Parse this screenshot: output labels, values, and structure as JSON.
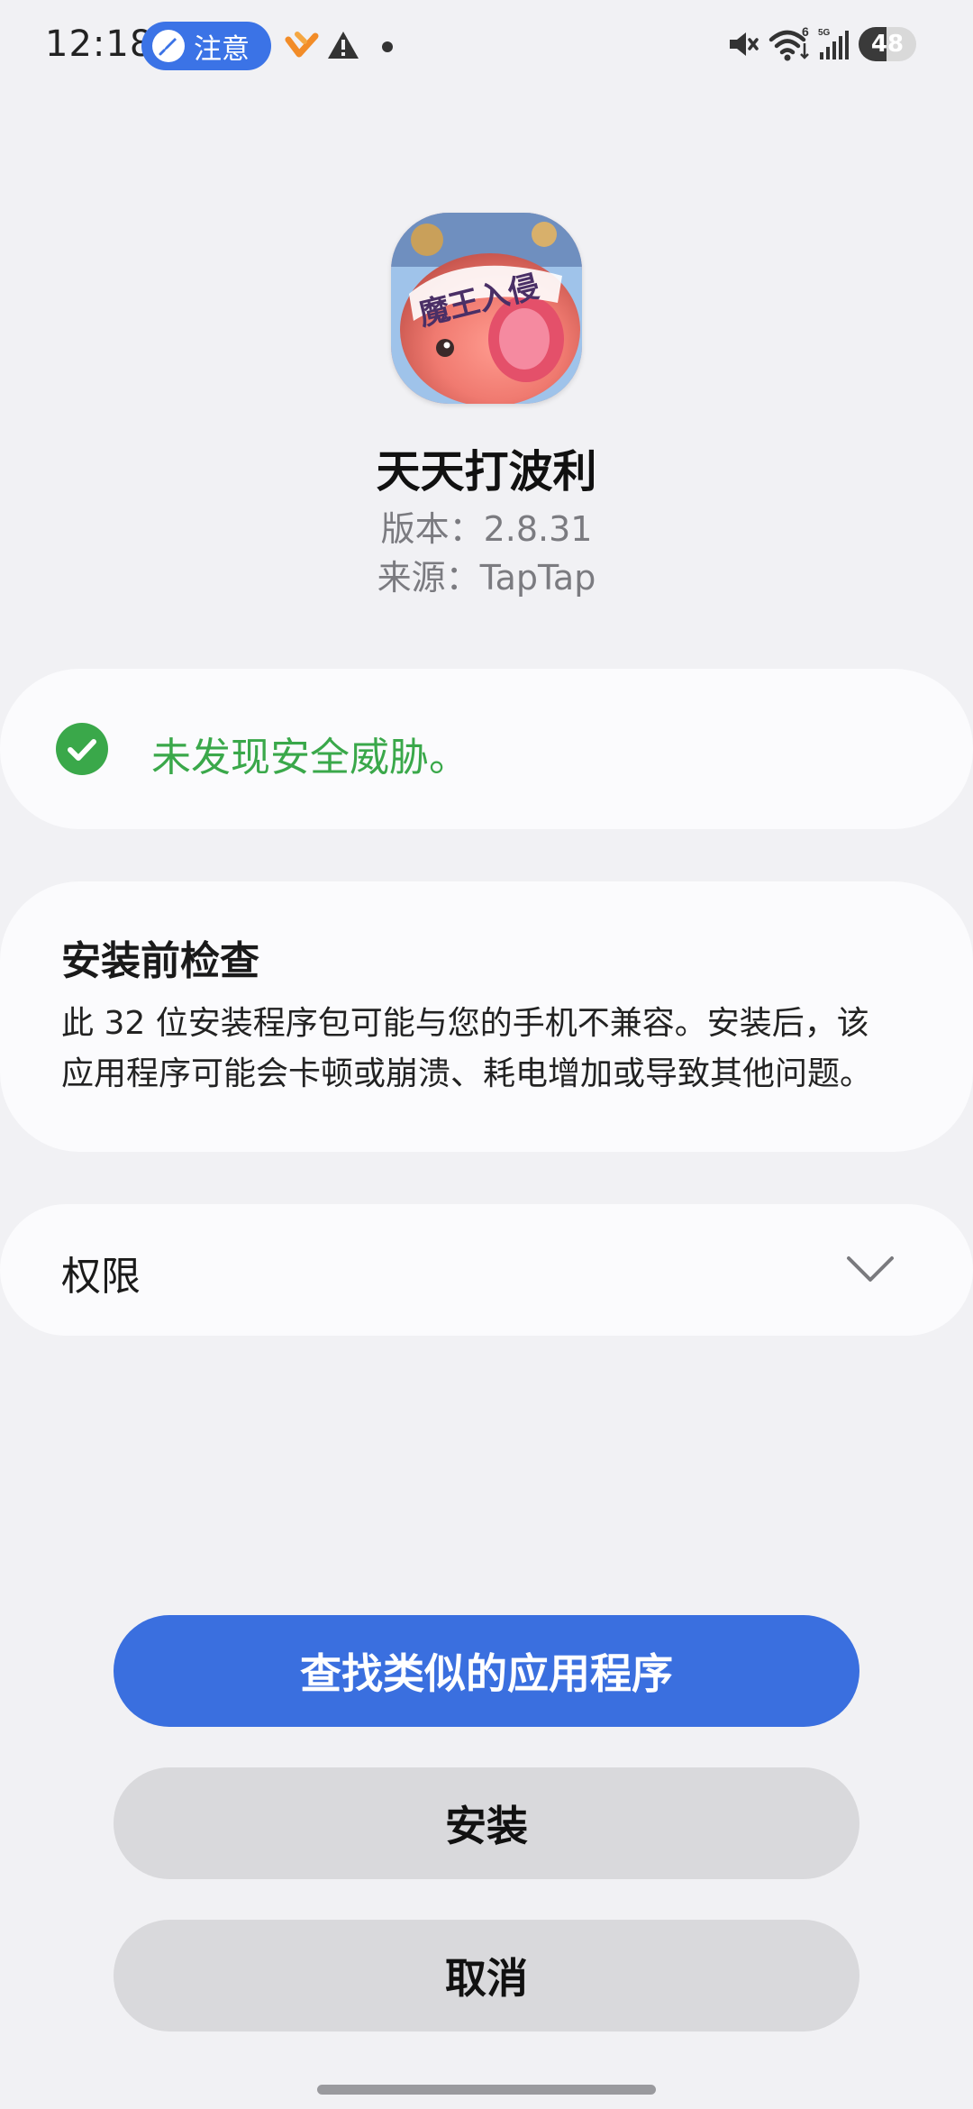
{
  "status_bar": {
    "time": "12:18",
    "notice_label": "注意",
    "battery_level": "48",
    "battery_fraction": 0.48,
    "wifi_badge": "6",
    "cellular_badge": "5G",
    "icons": [
      "rocket-icon",
      "heart-app-icon",
      "warning-icon",
      "dot-icon",
      "mute-icon",
      "wifi-icon",
      "cellular-signal-icon",
      "battery-icon"
    ]
  },
  "app": {
    "name": "天天打波利",
    "version_line": "版本：2.8.31",
    "source_line": "来源：TapTap",
    "icon_text": "魔王入侵"
  },
  "security": {
    "message": "未发现安全威胁。",
    "status_color": "#3aa84a",
    "icon": "check-circle-icon"
  },
  "precheck": {
    "title": "安装前检查",
    "body_line1": "此 32 位安装程序包可能与您的手机不兼容。安装后，该",
    "body_line2": "应用程序可能会卡顿或崩溃、耗电增加或导致其他问题。"
  },
  "permissions": {
    "label": "权限",
    "icon": "chevron-down-icon"
  },
  "buttons": {
    "find_similar": "查找类似的应用程序",
    "install": "安装",
    "cancel": "取消"
  },
  "colors": {
    "accent": "#3a6fdf",
    "background": "#f1f1f4",
    "card": "#fbfbfd",
    "secondary_button": "#d9d9dc"
  }
}
